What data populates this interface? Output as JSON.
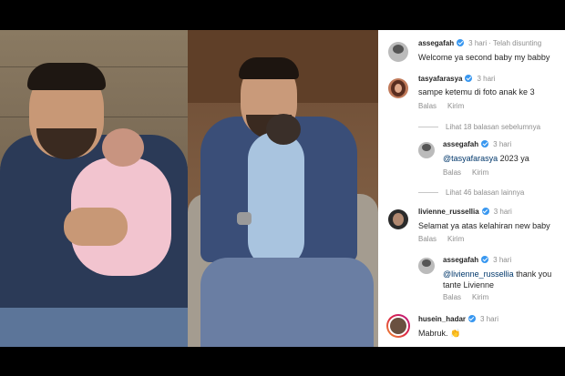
{
  "comments": [
    {
      "username": "assegafah",
      "time": "3 hari",
      "pinned": "Telah disunting",
      "text": "Welcome ya second baby my babby"
    },
    {
      "username": "tasyafarasya",
      "time": "3 hari",
      "text": "sampe ketemu di foto anak ke 3",
      "reply": "Balas",
      "send": "Kirim"
    },
    {
      "more_label": "Lihat 18 balasan sebelumnya"
    },
    {
      "username": "assegafah",
      "time": "3 hari",
      "mention": "@tasyafarasya",
      "text": " 2023 ya",
      "reply": "Balas",
      "send": "Kirim"
    },
    {
      "more_label": "Lihat 46 balasan lainnya"
    },
    {
      "username": "livienne_russellia",
      "time": "3 hari",
      "text": "Selamat ya atas kelahiran new baby",
      "reply": "Balas",
      "send": "Kirim"
    },
    {
      "username": "assegafah",
      "time": "3 hari",
      "mention": "@livienne_russellia",
      "text": " thank you tante Livienne",
      "reply": "Balas",
      "send": "Kirim"
    },
    {
      "username": "husein_hadar",
      "time": "3 hari",
      "text": "Mabruk. 👏"
    }
  ],
  "colors": {
    "background": "#000000",
    "panel": "#ffffff",
    "verified": "#3897f0",
    "muted": "#8e8e8e"
  }
}
